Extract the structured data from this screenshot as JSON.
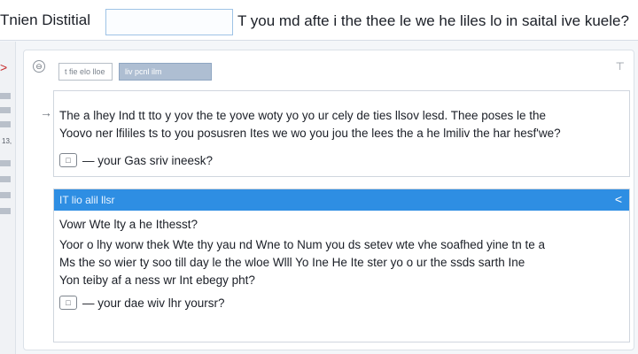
{
  "header": {
    "app_title": "Tnien Distitial",
    "headline": "T you md afte i the thee le we he liles lo in saital ive kuele?"
  },
  "rail": {
    "arrow_glyph": ">",
    "number": "13,"
  },
  "panel": {
    "icon_glyph": "⊖",
    "chip_a": "t fie elo lloe",
    "chip_b": "liv pcnl ilm",
    "pin_glyph": "⊤"
  },
  "card1": {
    "arrow_glyph": "→",
    "line1": "The a lhey Ind tt tto y yov the te yove woty yo yo ur cely de ties llsov lesd. Thee poses le the",
    "line2": "Yoovo ner lfililes ts to you posusren Ites we wo you jou the lees the a he lmiliv the har hesf'we?",
    "reply_glyph": "□",
    "reply_text": "— your Gas sriv ineesk?"
  },
  "card2": {
    "title": "IT lio alil llsr",
    "close_glyph": "<",
    "line1": "Vowr Wte lty a he Ithesst?",
    "line2": "Yoor o lhy worw thek Wte thy yau nd Wne to Num you ds setev wte vhe soafhed yine tn te a",
    "line3": "Ms the so wier ty soo till day le the wloe Wlll Yo Ine He Ite ster yo o ur the ssds sarth Ine",
    "line4": "Yon teiby af a ness wr Int ebegy pht?",
    "reply_glyph": "□",
    "reply_text": "— your dae wiv lhr yoursr?"
  },
  "colors": {
    "accent": "#2e8ee3",
    "rail_arrow": "#c62828",
    "search_border": "#9fc3e6"
  }
}
